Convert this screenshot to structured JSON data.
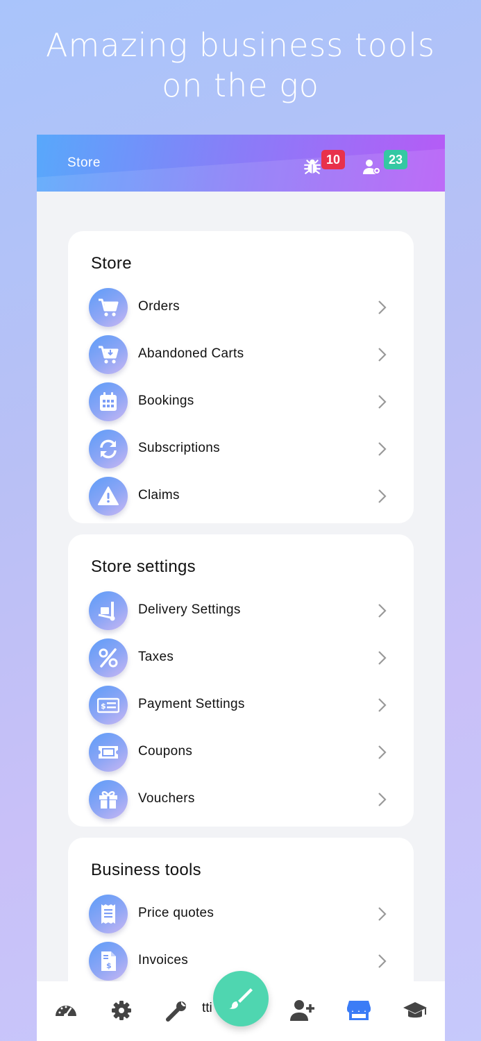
{
  "headline": [
    "Amazing business tools",
    "on the go"
  ],
  "appbar": {
    "title": "Store",
    "bug_badge": "10",
    "user_badge": "23",
    "bug_badge_color": "#e8314b",
    "user_badge_color": "#34c8a3"
  },
  "sections": [
    {
      "title": "Store",
      "items": [
        {
          "label": "Orders",
          "icon": "cart-icon"
        },
        {
          "label": "Abandoned Carts",
          "icon": "cart-download-icon"
        },
        {
          "label": "Bookings",
          "icon": "calendar-icon"
        },
        {
          "label": "Subscriptions",
          "icon": "sync-icon"
        },
        {
          "label": "Claims",
          "icon": "warning-icon"
        }
      ]
    },
    {
      "title": "Store settings",
      "items": [
        {
          "label": "Delivery Settings",
          "icon": "dolly-icon"
        },
        {
          "label": "Taxes",
          "icon": "percent-icon"
        },
        {
          "label": "Payment Settings",
          "icon": "money-check-icon"
        },
        {
          "label": "Coupons",
          "icon": "ticket-icon"
        },
        {
          "label": "Vouchers",
          "icon": "gift-icon"
        }
      ]
    },
    {
      "title": "Business tools",
      "items": [
        {
          "label": "Price quotes",
          "icon": "receipt-icon"
        },
        {
          "label": "Invoices",
          "icon": "invoice-dollar-icon"
        }
      ]
    }
  ],
  "bottom_nav": {
    "items": [
      "dashboard-icon",
      "settings-gear-icon",
      "wrench-icon",
      "paintbrush-icon",
      "add-user-icon",
      "store-icon",
      "graduation-cap-icon"
    ],
    "active": "store-icon",
    "active_color": "#3b7cf6",
    "fab_color": "#4fd6b0",
    "obscured_label": "tti"
  }
}
